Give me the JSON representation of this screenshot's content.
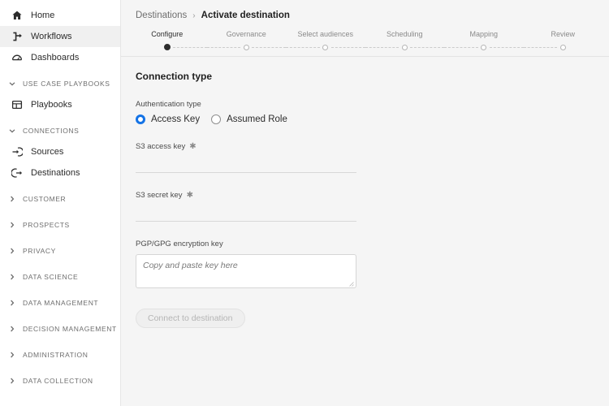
{
  "sidebar": {
    "top_items": [
      {
        "label": "Home",
        "icon": "home-icon",
        "selected": false
      },
      {
        "label": "Workflows",
        "icon": "workflows-icon",
        "selected": true
      },
      {
        "label": "Dashboards",
        "icon": "dashboards-icon",
        "selected": false
      }
    ],
    "sections": [
      {
        "label": "USE CASE PLAYBOOKS",
        "expanded": true,
        "items": [
          {
            "label": "Playbooks",
            "icon": "playbooks-icon"
          }
        ]
      },
      {
        "label": "CONNECTIONS",
        "expanded": true,
        "items": [
          {
            "label": "Sources",
            "icon": "sources-icon"
          },
          {
            "label": "Destinations",
            "icon": "destinations-icon"
          }
        ]
      },
      {
        "label": "CUSTOMER",
        "expanded": false,
        "items": []
      },
      {
        "label": "PROSPECTS",
        "expanded": false,
        "items": []
      },
      {
        "label": "PRIVACY",
        "expanded": false,
        "items": []
      },
      {
        "label": "DATA SCIENCE",
        "expanded": false,
        "items": []
      },
      {
        "label": "DATA MANAGEMENT",
        "expanded": false,
        "items": []
      },
      {
        "label": "DECISION MANAGEMENT",
        "expanded": false,
        "items": []
      },
      {
        "label": "ADMINISTRATION",
        "expanded": false,
        "items": []
      },
      {
        "label": "DATA COLLECTION",
        "expanded": false,
        "items": []
      }
    ]
  },
  "header": {
    "breadcrumb": {
      "parent": "Destinations",
      "separator": "›",
      "current": "Activate destination"
    },
    "steps": [
      {
        "label": "Configure",
        "active": true
      },
      {
        "label": "Governance",
        "active": false
      },
      {
        "label": "Select audiences",
        "active": false
      },
      {
        "label": "Scheduling",
        "active": false
      },
      {
        "label": "Mapping",
        "active": false
      },
      {
        "label": "Review",
        "active": false
      }
    ]
  },
  "form": {
    "panel_title": "Connection type",
    "auth_label": "Authentication type",
    "auth_options": [
      {
        "label": "Access Key",
        "checked": true
      },
      {
        "label": "Assumed Role",
        "checked": false
      }
    ],
    "fields": [
      {
        "label": "S3 access key",
        "required": true,
        "value": ""
      },
      {
        "label": "S3 secret key",
        "required": true,
        "value": ""
      }
    ],
    "pgp": {
      "label": "PGP/GPG encryption key",
      "required": false,
      "placeholder": "Copy and paste key here",
      "value": ""
    },
    "submit_label": "Connect to destination",
    "required_marker": "✱"
  },
  "colors": {
    "accent": "#1473e6",
    "sidebar_selected": "#f0f0f0",
    "main_bg": "#f5f5f5",
    "text": "#2c2c2c",
    "muted": "#8a8a8a"
  }
}
